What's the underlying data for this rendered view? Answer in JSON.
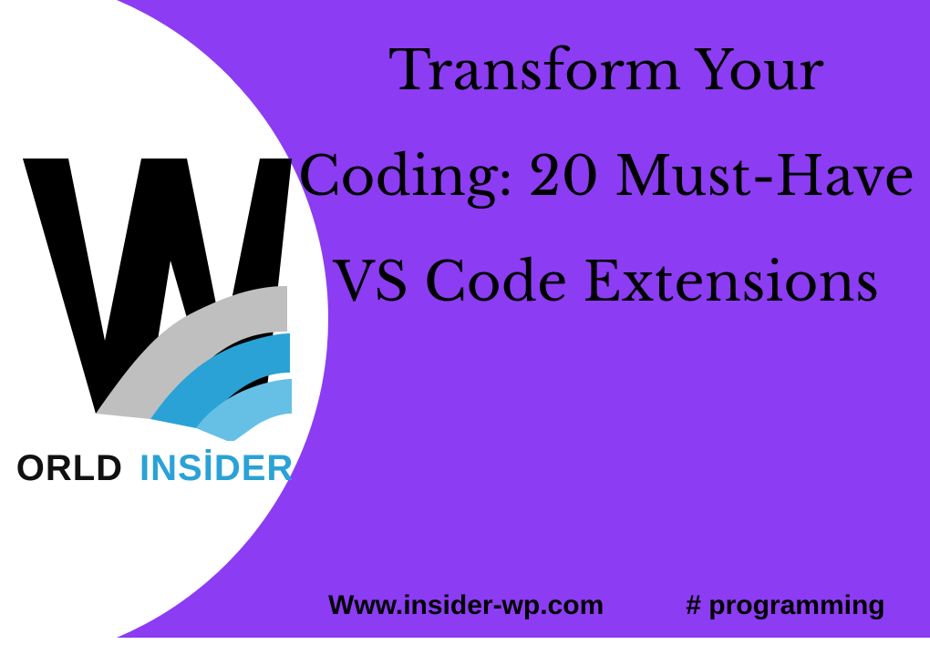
{
  "colors": {
    "background": "#8c3cf2",
    "white": "#ffffff",
    "logo_accent": "#2aa2d6",
    "logo_dark": "#000000"
  },
  "logo": {
    "text_part1": "ORLD",
    "text_part2": "INSİDER",
    "mark_description": "W mark in black with stylized ribbon stroke transitioning to blue"
  },
  "headline": "Transform Your Coding: 20 Must-Have VS Code Extensions",
  "footer": {
    "url": "Www.insider-wp.com",
    "tag": "#  programming"
  }
}
